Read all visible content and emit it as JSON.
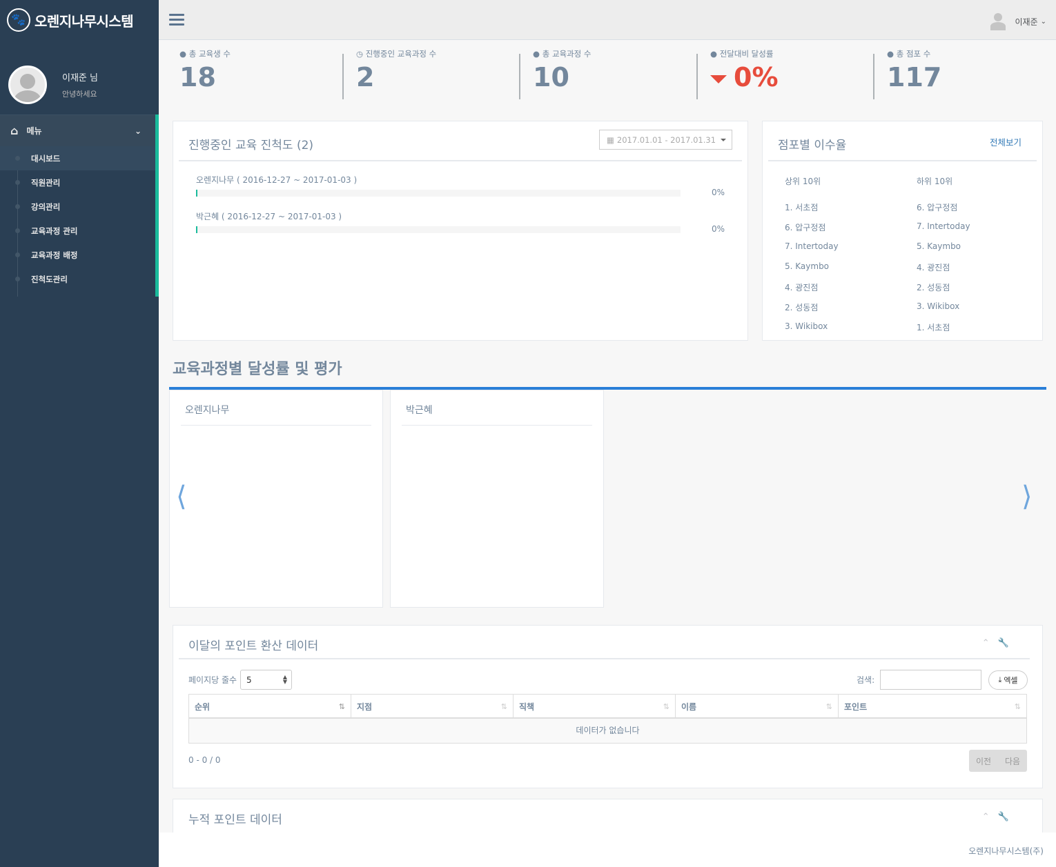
{
  "brand": {
    "title": "오렌지나무시스템",
    "icon": "paw-icon"
  },
  "profile": {
    "name": "이재준 님",
    "greeting": "안녕하세요"
  },
  "menu": {
    "header": "메뉴",
    "items": [
      {
        "label": "대시보드",
        "active": true
      },
      {
        "label": "직원관리"
      },
      {
        "label": "강의관리"
      },
      {
        "label": "교육과정 관리"
      },
      {
        "label": "교육과정 배정"
      },
      {
        "label": "진척도관리"
      }
    ]
  },
  "topnav": {
    "user": "이재준"
  },
  "tiles": [
    {
      "icon": "user-icon",
      "label": "총 교육생 수",
      "value": "18"
    },
    {
      "icon": "clock-icon",
      "label": "진행중인 교육과정 수",
      "value": "2"
    },
    {
      "icon": "user-icon",
      "label": "총 교육과정 수",
      "value": "10"
    },
    {
      "icon": "user-icon",
      "label": "전달대비 달성률",
      "value": "0%"
    },
    {
      "icon": "user-icon",
      "label": "총 점포 수",
      "value": "117"
    }
  ],
  "progress_panel": {
    "title": "진행중인 교육 진척도 (2)",
    "date_range": "2017.01.01 - 2017.01.31",
    "items": [
      {
        "name": "오렌지나무 ( 2016-12-27 ~ 2017-01-03 )",
        "percent": "0%",
        "value": 0
      },
      {
        "name": "박근혜 ( 2016-12-27 ~ 2017-01-03 )",
        "percent": "0%",
        "value": 0
      }
    ]
  },
  "ranking_panel": {
    "title": "점포별 이수율",
    "view_all": "전체보기",
    "top_header": "상위 10위",
    "bottom_header": "하위 10위",
    "top": [
      "1. 서초점",
      "6. 압구정점",
      "7. Intertoday",
      "5. Kaymbo",
      "4. 광진점",
      "2. 성동점",
      "3. Wikibox"
    ],
    "bottom": [
      "6. 압구정점",
      "7. Intertoday",
      "5. Kaymbo",
      "4. 광진점",
      "2. 성동점",
      "3. Wikibox",
      "1. 서초점"
    ]
  },
  "course_section": {
    "title": "교육과정별 달성률 및 평가",
    "cards": [
      "오렌지나무",
      "박근혜"
    ]
  },
  "points_panel": {
    "title": "이달의 포인트 환산 데이터",
    "page_size_label": "페이지당 줄수",
    "page_size": "5",
    "search_label": "검색:",
    "excel_label": "엑셀",
    "columns": [
      "순위",
      "지점",
      "직책",
      "이름",
      "포인트"
    ],
    "empty_message": "데이터가 없습니다",
    "info": "0 - 0 / 0",
    "prev": "이전",
    "next": "다음"
  },
  "cumulative_panel": {
    "title": "누적 포인트 데이터"
  },
  "footer": {
    "text": "오렌지나무시스템(주)"
  },
  "colors": {
    "sidebar": "#2a3f54",
    "accent_green": "#1abb9c",
    "accent_blue": "#2a7fd8",
    "danger": "#e74c3c"
  }
}
